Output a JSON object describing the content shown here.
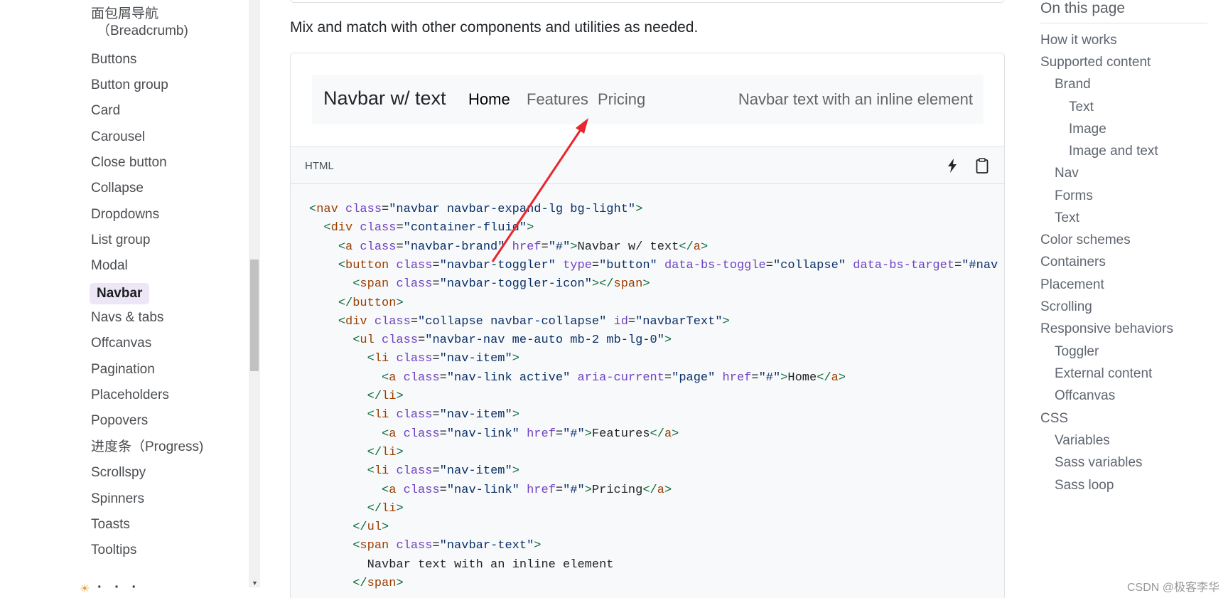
{
  "sidebar": {
    "items": [
      {
        "label": "面包屑导航",
        "sub": "（Breadcrumb)"
      },
      {
        "label": "Buttons"
      },
      {
        "label": "Button group"
      },
      {
        "label": "Card"
      },
      {
        "label": "Carousel"
      },
      {
        "label": "Close button"
      },
      {
        "label": "Collapse"
      },
      {
        "label": "Dropdowns"
      },
      {
        "label": "List group"
      },
      {
        "label": "Modal"
      },
      {
        "label": "Navbar",
        "active": true
      },
      {
        "label": "Navs & tabs"
      },
      {
        "label": "Offcanvas"
      },
      {
        "label": "Pagination"
      },
      {
        "label": "Placeholders"
      },
      {
        "label": "Popovers"
      },
      {
        "label": "进度条（Progress)"
      },
      {
        "label": "Scrollspy"
      },
      {
        "label": "Spinners"
      },
      {
        "label": "Toasts"
      },
      {
        "label": "Tooltips"
      }
    ]
  },
  "main": {
    "intro": "Mix and match with other components and utilities as needed.",
    "demo": {
      "brand": "Navbar w/ text",
      "links": [
        "Home",
        "Features",
        "Pricing"
      ],
      "active_link": "Home",
      "text": "Navbar text with an inline element"
    },
    "code": {
      "lang": "HTML",
      "icons": [
        "lightning-icon",
        "clipboard-icon"
      ],
      "lines": [
        [
          [
            "tg",
            "<"
          ],
          [
            "tgn",
            "nav"
          ],
          [
            "t",
            " "
          ],
          [
            "at",
            "class"
          ],
          [
            "t",
            "="
          ],
          [
            "av",
            "\"navbar navbar-expand-lg bg-light\""
          ],
          [
            "tg",
            ">"
          ]
        ],
        [
          [
            "t",
            "  "
          ],
          [
            "tg",
            "<"
          ],
          [
            "tgn",
            "div"
          ],
          [
            "t",
            " "
          ],
          [
            "at",
            "class"
          ],
          [
            "t",
            "="
          ],
          [
            "av",
            "\"container-fluid\""
          ],
          [
            "tg",
            ">"
          ]
        ],
        [
          [
            "t",
            "    "
          ],
          [
            "tg",
            "<"
          ],
          [
            "tgn",
            "a"
          ],
          [
            "t",
            " "
          ],
          [
            "at",
            "class"
          ],
          [
            "t",
            "="
          ],
          [
            "av",
            "\"navbar-brand\""
          ],
          [
            "t",
            " "
          ],
          [
            "at",
            "href"
          ],
          [
            "t",
            "="
          ],
          [
            "av",
            "\"#\""
          ],
          [
            "tg",
            ">"
          ],
          [
            "t",
            "Navbar w/ text"
          ],
          [
            "tg",
            "</"
          ],
          [
            "tgn",
            "a"
          ],
          [
            "tg",
            ">"
          ]
        ],
        [
          [
            "t",
            "    "
          ],
          [
            "tg",
            "<"
          ],
          [
            "tgn",
            "button"
          ],
          [
            "t",
            " "
          ],
          [
            "at",
            "class"
          ],
          [
            "t",
            "="
          ],
          [
            "av",
            "\"navbar-toggler\""
          ],
          [
            "t",
            " "
          ],
          [
            "at",
            "type"
          ],
          [
            "t",
            "="
          ],
          [
            "av",
            "\"button\""
          ],
          [
            "t",
            " "
          ],
          [
            "at",
            "data-bs-toggle"
          ],
          [
            "t",
            "="
          ],
          [
            "av",
            "\"collapse\""
          ],
          [
            "t",
            " "
          ],
          [
            "at",
            "data-bs-target"
          ],
          [
            "t",
            "="
          ],
          [
            "av",
            "\"#nav"
          ]
        ],
        [
          [
            "t",
            "      "
          ],
          [
            "tg",
            "<"
          ],
          [
            "tgn",
            "span"
          ],
          [
            "t",
            " "
          ],
          [
            "at",
            "class"
          ],
          [
            "t",
            "="
          ],
          [
            "av",
            "\"navbar-toggler-icon\""
          ],
          [
            "tg",
            "></"
          ],
          [
            "tgn",
            "span"
          ],
          [
            "tg",
            ">"
          ]
        ],
        [
          [
            "t",
            "    "
          ],
          [
            "tg",
            "</"
          ],
          [
            "tgn",
            "button"
          ],
          [
            "tg",
            ">"
          ]
        ],
        [
          [
            "t",
            "    "
          ],
          [
            "tg",
            "<"
          ],
          [
            "tgn",
            "div"
          ],
          [
            "t",
            " "
          ],
          [
            "at",
            "class"
          ],
          [
            "t",
            "="
          ],
          [
            "av",
            "\"collapse navbar-collapse\""
          ],
          [
            "t",
            " "
          ],
          [
            "at",
            "id"
          ],
          [
            "t",
            "="
          ],
          [
            "av",
            "\"navbarText\""
          ],
          [
            "tg",
            ">"
          ]
        ],
        [
          [
            "t",
            "      "
          ],
          [
            "tg",
            "<"
          ],
          [
            "tgn",
            "ul"
          ],
          [
            "t",
            " "
          ],
          [
            "at",
            "class"
          ],
          [
            "t",
            "="
          ],
          [
            "av",
            "\"navbar-nav me-auto mb-2 mb-lg-0\""
          ],
          [
            "tg",
            ">"
          ]
        ],
        [
          [
            "t",
            "        "
          ],
          [
            "tg",
            "<"
          ],
          [
            "tgn",
            "li"
          ],
          [
            "t",
            " "
          ],
          [
            "at",
            "class"
          ],
          [
            "t",
            "="
          ],
          [
            "av",
            "\"nav-item\""
          ],
          [
            "tg",
            ">"
          ]
        ],
        [
          [
            "t",
            "          "
          ],
          [
            "tg",
            "<"
          ],
          [
            "tgn",
            "a"
          ],
          [
            "t",
            " "
          ],
          [
            "at",
            "class"
          ],
          [
            "t",
            "="
          ],
          [
            "av",
            "\"nav-link active\""
          ],
          [
            "t",
            " "
          ],
          [
            "at",
            "aria-current"
          ],
          [
            "t",
            "="
          ],
          [
            "av",
            "\"page\""
          ],
          [
            "t",
            " "
          ],
          [
            "at",
            "href"
          ],
          [
            "t",
            "="
          ],
          [
            "av",
            "\"#\""
          ],
          [
            "tg",
            ">"
          ],
          [
            "t",
            "Home"
          ],
          [
            "tg",
            "</"
          ],
          [
            "tgn",
            "a"
          ],
          [
            "tg",
            ">"
          ]
        ],
        [
          [
            "t",
            "        "
          ],
          [
            "tg",
            "</"
          ],
          [
            "tgn",
            "li"
          ],
          [
            "tg",
            ">"
          ]
        ],
        [
          [
            "t",
            "        "
          ],
          [
            "tg",
            "<"
          ],
          [
            "tgn",
            "li"
          ],
          [
            "t",
            " "
          ],
          [
            "at",
            "class"
          ],
          [
            "t",
            "="
          ],
          [
            "av",
            "\"nav-item\""
          ],
          [
            "tg",
            ">"
          ]
        ],
        [
          [
            "t",
            "          "
          ],
          [
            "tg",
            "<"
          ],
          [
            "tgn",
            "a"
          ],
          [
            "t",
            " "
          ],
          [
            "at",
            "class"
          ],
          [
            "t",
            "="
          ],
          [
            "av",
            "\"nav-link\""
          ],
          [
            "t",
            " "
          ],
          [
            "at",
            "href"
          ],
          [
            "t",
            "="
          ],
          [
            "av",
            "\"#\""
          ],
          [
            "tg",
            ">"
          ],
          [
            "t",
            "Features"
          ],
          [
            "tg",
            "</"
          ],
          [
            "tgn",
            "a"
          ],
          [
            "tg",
            ">"
          ]
        ],
        [
          [
            "t",
            "        "
          ],
          [
            "tg",
            "</"
          ],
          [
            "tgn",
            "li"
          ],
          [
            "tg",
            ">"
          ]
        ],
        [
          [
            "t",
            "        "
          ],
          [
            "tg",
            "<"
          ],
          [
            "tgn",
            "li"
          ],
          [
            "t",
            " "
          ],
          [
            "at",
            "class"
          ],
          [
            "t",
            "="
          ],
          [
            "av",
            "\"nav-item\""
          ],
          [
            "tg",
            ">"
          ]
        ],
        [
          [
            "t",
            "          "
          ],
          [
            "tg",
            "<"
          ],
          [
            "tgn",
            "a"
          ],
          [
            "t",
            " "
          ],
          [
            "at",
            "class"
          ],
          [
            "t",
            "="
          ],
          [
            "av",
            "\"nav-link\""
          ],
          [
            "t",
            " "
          ],
          [
            "at",
            "href"
          ],
          [
            "t",
            "="
          ],
          [
            "av",
            "\"#\""
          ],
          [
            "tg",
            ">"
          ],
          [
            "t",
            "Pricing"
          ],
          [
            "tg",
            "</"
          ],
          [
            "tgn",
            "a"
          ],
          [
            "tg",
            ">"
          ]
        ],
        [
          [
            "t",
            "        "
          ],
          [
            "tg",
            "</"
          ],
          [
            "tgn",
            "li"
          ],
          [
            "tg",
            ">"
          ]
        ],
        [
          [
            "t",
            "      "
          ],
          [
            "tg",
            "</"
          ],
          [
            "tgn",
            "ul"
          ],
          [
            "tg",
            ">"
          ]
        ],
        [
          [
            "t",
            "      "
          ],
          [
            "tg",
            "<"
          ],
          [
            "tgn",
            "span"
          ],
          [
            "t",
            " "
          ],
          [
            "at",
            "class"
          ],
          [
            "t",
            "="
          ],
          [
            "av",
            "\"navbar-text\""
          ],
          [
            "tg",
            ">"
          ]
        ],
        [
          [
            "t",
            "        Navbar text with an inline element"
          ]
        ],
        [
          [
            "t",
            "      "
          ],
          [
            "tg",
            "</"
          ],
          [
            "tgn",
            "span"
          ],
          [
            "tg",
            ">"
          ]
        ]
      ]
    }
  },
  "toc": {
    "title": "On this page",
    "items": [
      {
        "label": "How it works",
        "level": 0
      },
      {
        "label": "Supported content",
        "level": 0
      },
      {
        "label": "Brand",
        "level": 1
      },
      {
        "label": "Text",
        "level": 2
      },
      {
        "label": "Image",
        "level": 2
      },
      {
        "label": "Image and text",
        "level": 2
      },
      {
        "label": "Nav",
        "level": 1
      },
      {
        "label": "Forms",
        "level": 1
      },
      {
        "label": "Text",
        "level": 1
      },
      {
        "label": "Color schemes",
        "level": 0
      },
      {
        "label": "Containers",
        "level": 0
      },
      {
        "label": "Placement",
        "level": 0
      },
      {
        "label": "Scrolling",
        "level": 0
      },
      {
        "label": "Responsive behaviors",
        "level": 0
      },
      {
        "label": "Toggler",
        "level": 1
      },
      {
        "label": "External content",
        "level": 1
      },
      {
        "label": "Offcanvas",
        "level": 1
      },
      {
        "label": "CSS",
        "level": 0
      },
      {
        "label": "Variables",
        "level": 1
      },
      {
        "label": "Sass variables",
        "level": 1
      },
      {
        "label": "Sass loop",
        "level": 1
      }
    ]
  },
  "watermark": "CSDN @极客李华",
  "colors": {
    "active_bg": "#ede6f7",
    "annotation_arrow": "#e8262d"
  }
}
